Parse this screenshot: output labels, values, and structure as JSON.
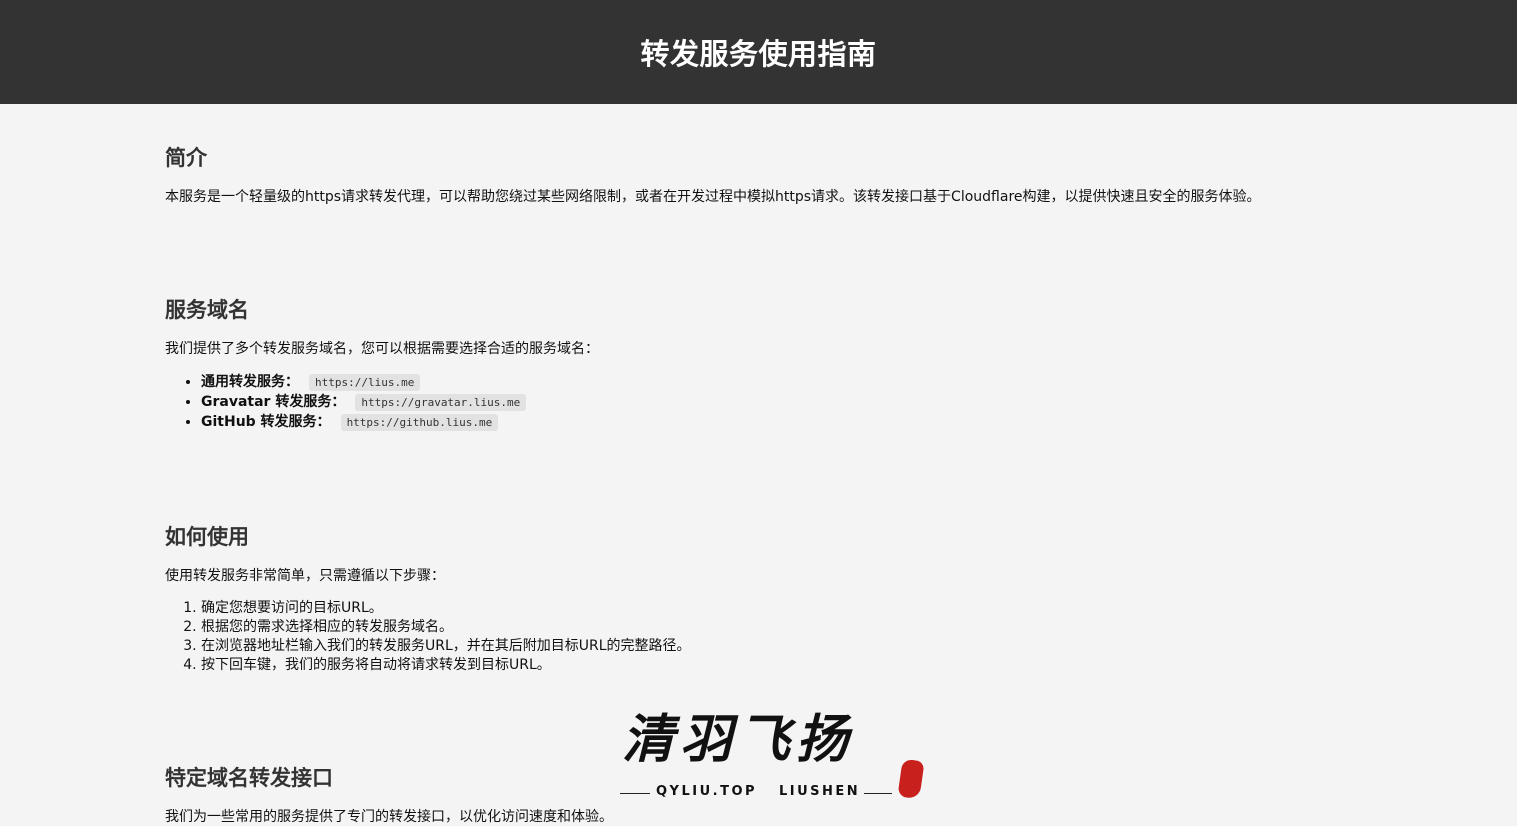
{
  "header": {
    "title": "转发服务使用指南"
  },
  "intro": {
    "heading": "简介",
    "text": "本服务是一个轻量级的https请求转发代理，可以帮助您绕过某些网络限制，或者在开发过程中模拟https请求。该转发接口基于Cloudflare构建，以提供快速且安全的服务体验。"
  },
  "domains": {
    "heading": "服务域名",
    "text": "我们提供了多个转发服务域名，您可以根据需要选择合适的服务域名：",
    "items": [
      {
        "label": "通用转发服务：",
        "url": "https://lius.me"
      },
      {
        "label": "Gravatar 转发服务：",
        "url": "https://gravatar.lius.me"
      },
      {
        "label": "GitHub 转发服务：",
        "url": "https://github.lius.me"
      }
    ]
  },
  "usage": {
    "heading": "如何使用",
    "text": "使用转发服务非常简单，只需遵循以下步骤：",
    "steps": [
      "确定您想要访问的目标URL。",
      "根据您的需求选择相应的转发服务域名。",
      "在浏览器地址栏输入我们的转发服务URL，并在其后附加目标URL的完整路径。",
      "按下回车键，我们的服务将自动将请求转发到目标URL。"
    ]
  },
  "specific": {
    "heading": "特定域名转发接口",
    "text": "我们为一些常用的服务提供了专门的转发接口，以优化访问速度和体验。"
  },
  "watermark": {
    "calligraphy": "清羽飞扬",
    "site": "QYLIU.TOP",
    "author": "LIUSHEN",
    "seal_color": "#c8201c"
  },
  "colors": {
    "header_bg": "#333333",
    "page_bg": "#f4f4f4",
    "code_bg": "#e2e2e2"
  }
}
